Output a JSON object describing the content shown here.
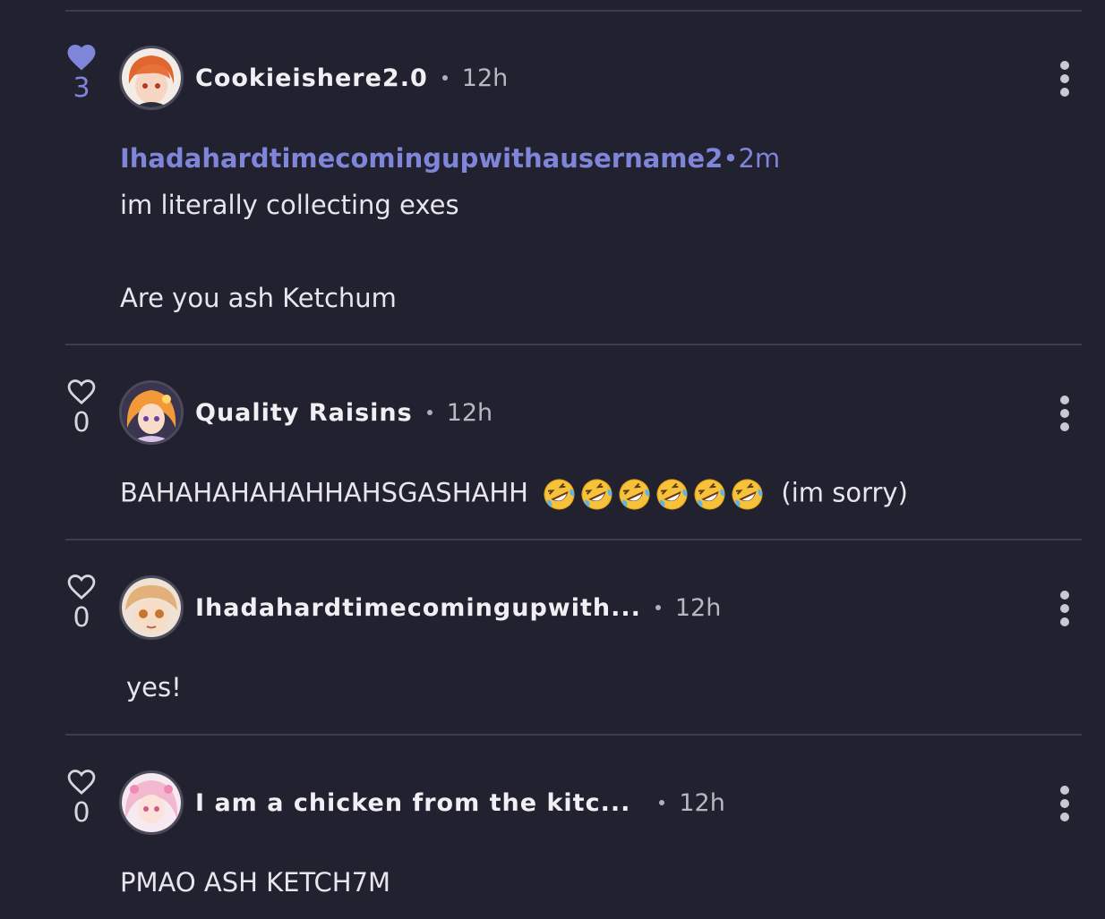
{
  "colors": {
    "background": "#21212f",
    "accent": "#7f85d9",
    "divider": "#3d3d4c"
  },
  "comments": [
    {
      "username": "Cookieishere2.0",
      "time": "12h",
      "likes": "3",
      "liked": true,
      "reply": {
        "mention": "Ihadahardtimecomingupwithausername2",
        "separator": "•",
        "mention_time": "2m",
        "line1": "im literally collecting exes",
        "line2": "Are you ash Ketchum"
      }
    },
    {
      "username": "Quality Raisins",
      "time": "12h",
      "likes": "0",
      "liked": false,
      "text_before": "BAHAHAHAHAHHAHSGASHAHH",
      "emoji_icon": "rolling-on-floor-laughing-icon",
      "emoji_count": 6,
      "text_after": "(im sorry)"
    },
    {
      "username": "Ihadahardtimecomingupwith...",
      "time": "12h",
      "likes": "0",
      "liked": false,
      "text": "yes!"
    },
    {
      "username": "I am a chicken from the kitc...",
      "time": "12h",
      "likes": "0",
      "liked": false,
      "text": "PMAO ASH KETCH7M"
    }
  ]
}
